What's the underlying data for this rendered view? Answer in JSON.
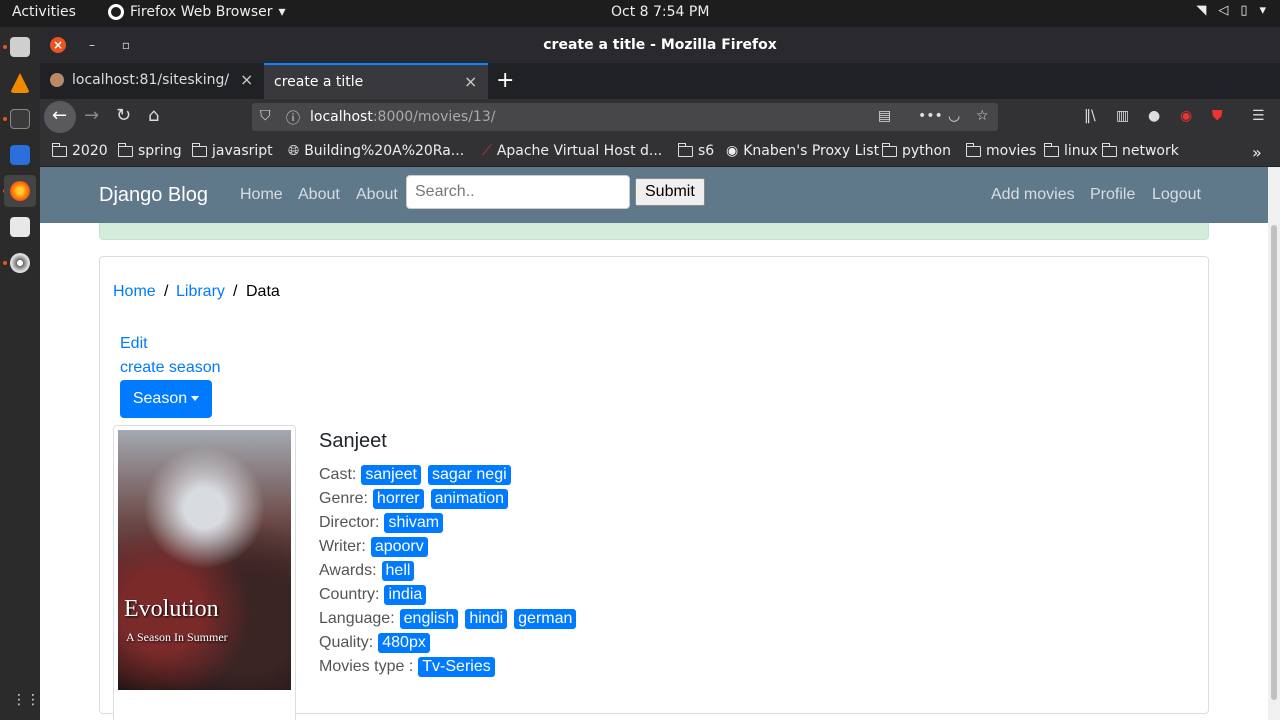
{
  "topbar": {
    "activities": "Activities",
    "app_name": "Firefox Web Browser",
    "clock": "Oct 8  7:54 PM"
  },
  "window": {
    "title": "create a title - Mozilla Firefox"
  },
  "tabs": [
    {
      "label": "localhost:81/sitesking/"
    },
    {
      "label": "create a title"
    }
  ],
  "url": {
    "host": "localhost",
    "path": ":8000/movies/13/"
  },
  "bookmarks": [
    {
      "label": "2020",
      "icon": "folder-icon"
    },
    {
      "label": "spring",
      "icon": "folder-icon"
    },
    {
      "label": "javasript",
      "icon": "folder-icon"
    },
    {
      "label": "Building%20A%20Ra...",
      "icon": "globe-icon"
    },
    {
      "label": "Apache Virtual Host d...",
      "icon": "feather-icon"
    },
    {
      "label": "s6",
      "icon": "folder-icon"
    },
    {
      "label": "Knaben's Proxy List",
      "icon": "circle-icon"
    },
    {
      "label": "python",
      "icon": "folder-icon"
    },
    {
      "label": "movies",
      "icon": "folder-icon"
    },
    {
      "label": "linux",
      "icon": "folder-icon"
    },
    {
      "label": "network",
      "icon": "folder-icon"
    }
  ],
  "site": {
    "brand": "Django Blog",
    "nav": [
      "Home",
      "About",
      "About"
    ],
    "search_placeholder": "Search..",
    "submit": "Submit",
    "right_nav": [
      "Add movies",
      "Profile",
      "Logout"
    ]
  },
  "breadcrumb": {
    "home": "Home",
    "library": "Library",
    "current": "Data",
    "sep": "/"
  },
  "actions": {
    "edit": "Edit",
    "create_season": "create season",
    "season": "Season"
  },
  "poster": {
    "title": "Evolution",
    "subtitle": "A Season In Summer"
  },
  "movie": {
    "title": "Sanjeet",
    "fields": [
      {
        "label": "Cast:",
        "values": [
          "sanjeet",
          "sagar negi"
        ]
      },
      {
        "label": "Genre:",
        "values": [
          "horrer",
          "animation"
        ]
      },
      {
        "label": "Director:",
        "values": [
          "shivam"
        ]
      },
      {
        "label": "Writer:",
        "values": [
          "apoorv"
        ]
      },
      {
        "label": "Awards:",
        "values": [
          "hell"
        ]
      },
      {
        "label": "Country:",
        "values": [
          "india"
        ]
      },
      {
        "label": "Language:",
        "values": [
          "english",
          "hindi",
          "german"
        ]
      },
      {
        "label": "Quality:",
        "values": [
          "480px"
        ]
      },
      {
        "label": "Movies type :",
        "values": [
          "Tv-Series"
        ]
      }
    ]
  },
  "colors": {
    "primary": "#007bff",
    "navbar": "#5f788a",
    "alert": "#d4edda"
  }
}
